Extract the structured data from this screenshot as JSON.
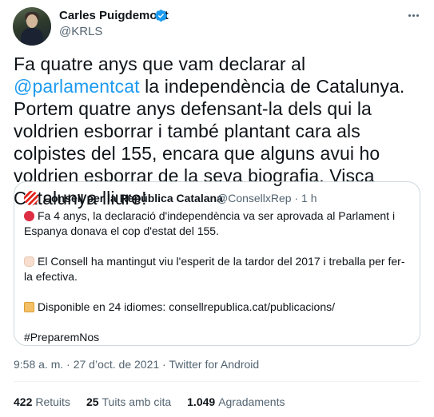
{
  "author": {
    "display_name": "Carles Puigdemont",
    "handle": "@KRLS",
    "verified": true,
    "avatar_icon": "profile-photo"
  },
  "tweet": {
    "text_before": "Fa quatre anys que vam declarar al ",
    "mention": "@parlamentcat",
    "text_after": " la independència de Catalunya. Portem quatre anys defensant-la dels qui la voldrien esborrar i també plantant cara als colpistes del 155, encara que alguns avui ho voldrien esborrar de la seva biografia. Visca Catalunya lliure!"
  },
  "quoted": {
    "display_name": "Consell per la República Catalana",
    "handle_time": "@ConsellxRep · 1 h",
    "paragraphs": [
      {
        "emoji": "red-circle",
        "text": "Fa 4 anys, la declaració d'independència va ser aprovada al Parlament i Espanya donava el cop d'estat del 155."
      },
      {
        "emoji": "raised-fist",
        "text": "El Consell ha mantingut viu l'esperit de la tardor del 2017 i treballa per fer-la efectiva."
      },
      {
        "emoji": "scroll",
        "text": "Disponible en 24 idiomes: consellrepublica.cat/publicacions/"
      },
      {
        "emoji": "",
        "text": "#PreparemNos"
      }
    ]
  },
  "meta": {
    "time": "9:58 a. m.",
    "separator": " · ",
    "date": "27 d’oct. de 2021",
    "source": "Twitter for Android"
  },
  "stats": [
    {
      "value": "422",
      "label": "Retuits"
    },
    {
      "value": "25",
      "label": "Tuits amb cita"
    },
    {
      "value": "1.049",
      "label": "Agradaments"
    }
  ],
  "colors": {
    "accent": "#1d9bf0",
    "text": "#0f1419",
    "secondary": "#536471",
    "border": "#cfd9de"
  }
}
